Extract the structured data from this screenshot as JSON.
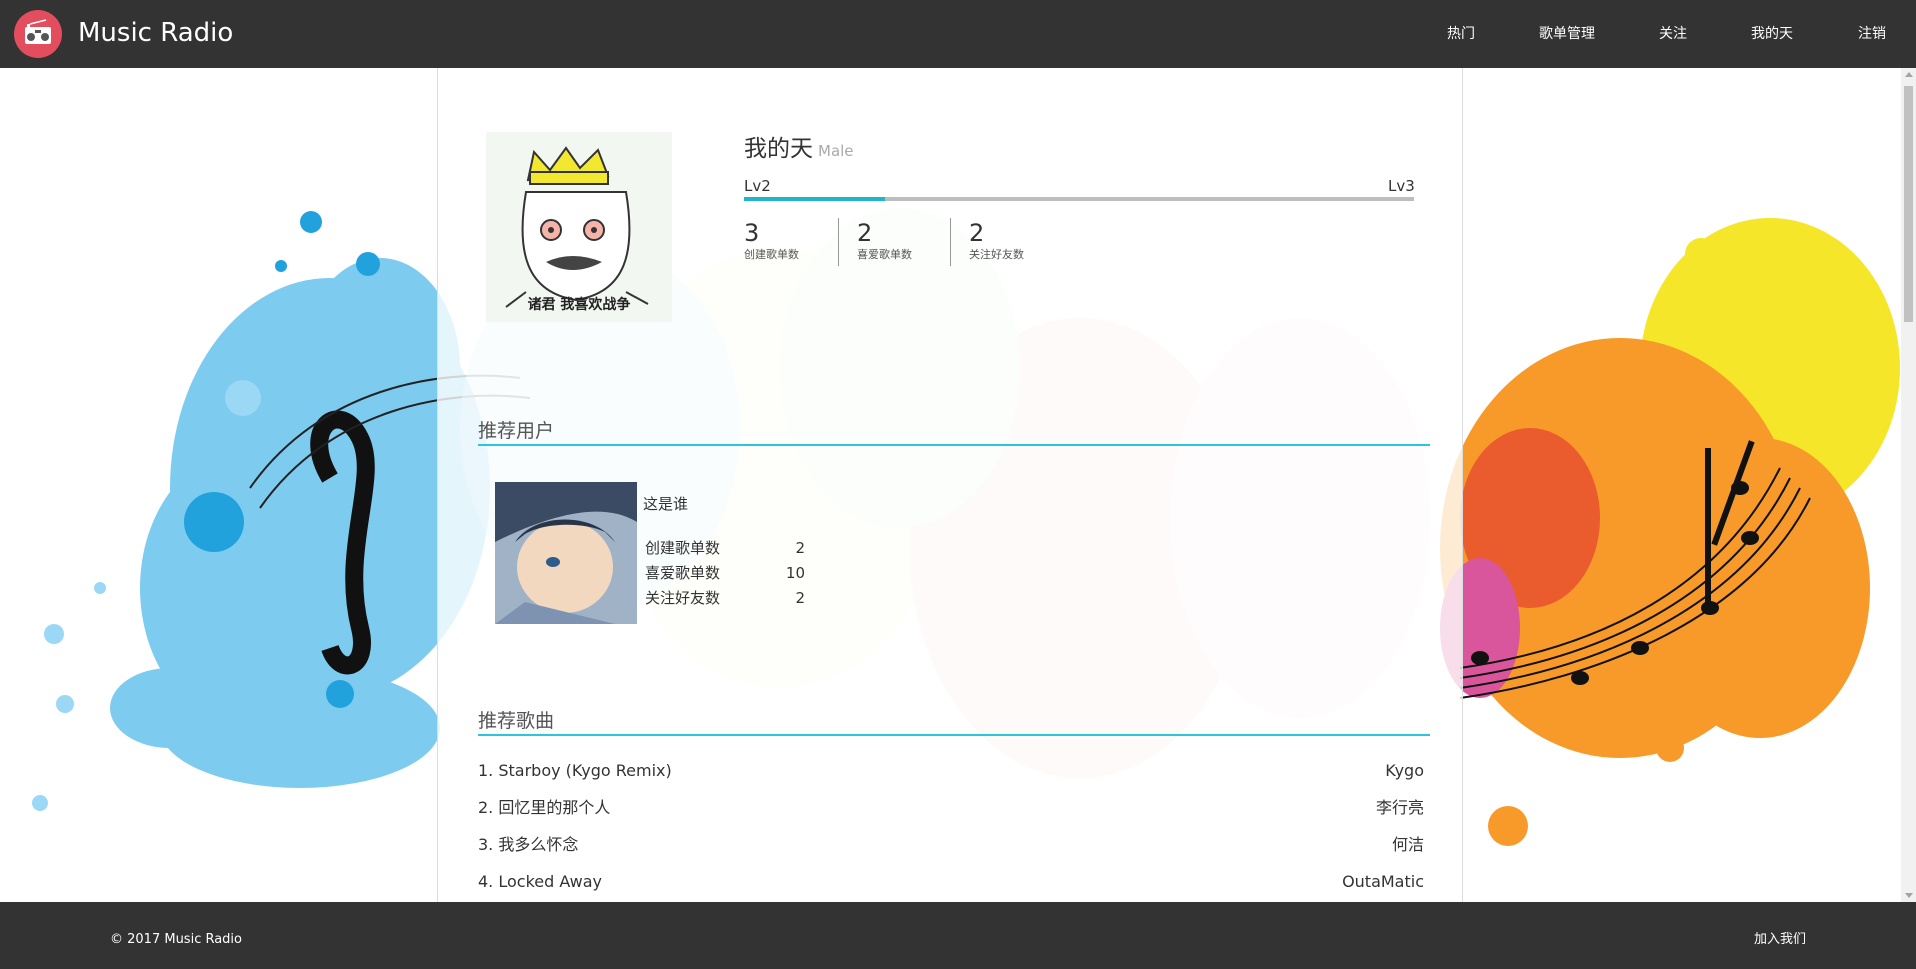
{
  "header": {
    "brand": "Music Radio",
    "nav": [
      "热门",
      "歌单管理",
      "关注",
      "我的天",
      "注销"
    ]
  },
  "profile": {
    "name": "我的天",
    "gender": "Male",
    "level_current": "Lv2",
    "level_next": "Lv3",
    "level_progress": 0.21,
    "stats": [
      {
        "value": "3",
        "label": "创建歌单数"
      },
      {
        "value": "2",
        "label": "喜爱歌单数"
      },
      {
        "value": "2",
        "label": "关注好友数"
      }
    ],
    "avatar_caption": "诸君 我喜欢战争"
  },
  "recommended_users": {
    "title": "推荐用户",
    "users": [
      {
        "name": "这是谁",
        "stats": [
          {
            "label": "创建歌单数",
            "value": "2"
          },
          {
            "label": "喜爱歌单数",
            "value": "10"
          },
          {
            "label": "关注好友数",
            "value": "2"
          }
        ]
      }
    ]
  },
  "recommended_songs": {
    "title": "推荐歌曲",
    "songs": [
      {
        "title": "1. Starboy (Kygo Remix)",
        "artist": "Kygo"
      },
      {
        "title": "2. 回忆里的那个人",
        "artist": "李行亮"
      },
      {
        "title": "3. 我多么怀念",
        "artist": "何洁"
      },
      {
        "title": "4. Locked Away",
        "artist": "OutaMatic"
      }
    ]
  },
  "footer": {
    "copyright": "© 2017 Music Radio",
    "join": "加入我们"
  },
  "colors": {
    "nav_bg": "#333333",
    "accent": "#29c6dc",
    "logo": "#e34e5f"
  }
}
